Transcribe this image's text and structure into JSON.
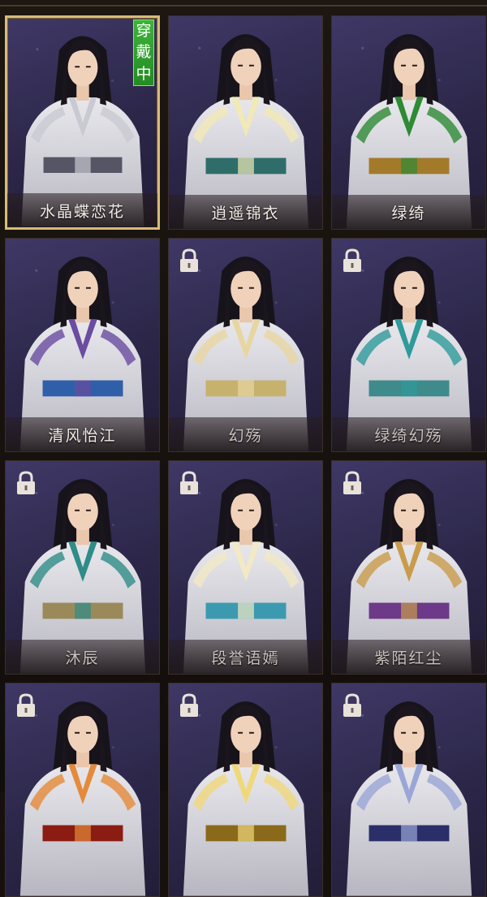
{
  "badge": [
    "穿",
    "戴",
    "中"
  ],
  "outfits": [
    {
      "name": "水晶蝶恋花",
      "selected": true,
      "locked": false,
      "robe": "#e8e8ec",
      "trim": "#c9c9d2",
      "sash": "#555566"
    },
    {
      "name": "逍遥锦衣",
      "selected": false,
      "locked": false,
      "robe": "#3b8f3e",
      "trim": "#f1e9b6",
      "sash": "#2e6d6a"
    },
    {
      "name": "绿绮",
      "selected": false,
      "locked": false,
      "robe": "#b9d63c",
      "trim": "#2e8a34",
      "sash": "#a27a2a"
    },
    {
      "name": "清风怡江",
      "selected": false,
      "locked": false,
      "robe": "#3f76c4",
      "trim": "#6a4ca0",
      "sash": "#2f5fa8"
    },
    {
      "name": "幻殇",
      "selected": false,
      "locked": true,
      "robe": "#52a64d",
      "trim": "#e8d6a2",
      "sash": "#c6b26d"
    },
    {
      "name": "绿绮幻殇",
      "selected": false,
      "locked": true,
      "robe": "#cfe3e2",
      "trim": "#2f9a9a",
      "sash": "#3f8a8a"
    },
    {
      "name": "沐辰",
      "selected": false,
      "locked": true,
      "robe": "#e6eeea",
      "trim": "#2f8c88",
      "sash": "#9a8a5a"
    },
    {
      "name": "段誉语嫣",
      "selected": false,
      "locked": true,
      "robe": "#d9b43a",
      "trim": "#f3e9c4",
      "sash": "#3c9ab0"
    },
    {
      "name": "紫陌红尘",
      "selected": false,
      "locked": true,
      "robe": "#5a2a22",
      "trim": "#c99b4a",
      "sash": "#6d3a8a"
    },
    {
      "name": "",
      "selected": false,
      "locked": true,
      "robe": "#c8351f",
      "trim": "#e58a3a",
      "sash": "#8a1c12"
    },
    {
      "name": "",
      "selected": false,
      "locked": true,
      "robe": "#c9a63a",
      "trim": "#f0d87a",
      "sash": "#8a6a1a"
    },
    {
      "name": "",
      "selected": false,
      "locked": true,
      "robe": "#3f4fa8",
      "trim": "#9aa6d6",
      "sash": "#2a2f6a"
    }
  ]
}
